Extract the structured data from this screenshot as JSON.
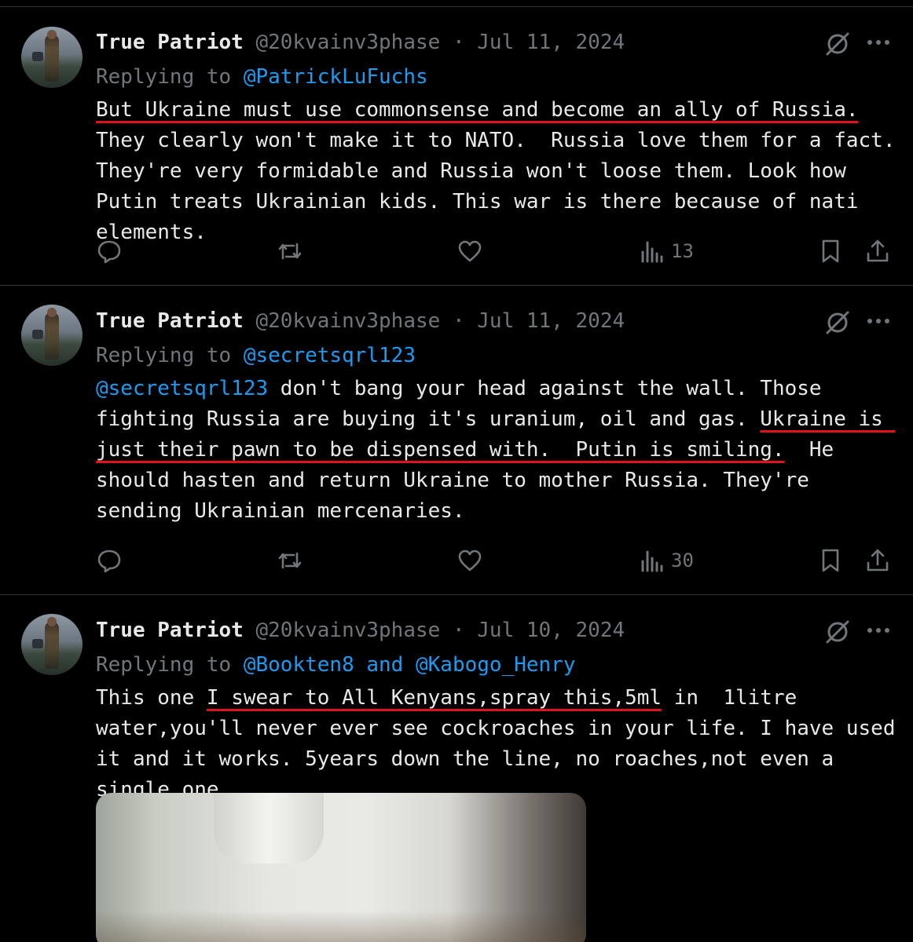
{
  "tweets": [
    {
      "author_name": "True Patriot",
      "handle": "@20kvainv3phase",
      "separator": "·",
      "date": "Jul 11, 2024",
      "replying_prefix": "Replying to ",
      "replying_to": "@PatrickLuFuchs",
      "text": {
        "underlined_1": "But Ukraine must use commonsense and become an ally of Russia.",
        "rest": "  They clearly won't make it to NATO.  Russia love them for a fact. They're very formidable and Russia won't loose them. Look how Putin treats Ukrainian kids. This war is there because of nati elements."
      },
      "views": "13"
    },
    {
      "author_name": "True Patriot",
      "handle": "@20kvainv3phase",
      "separator": "·",
      "date": "Jul 11, 2024",
      "replying_prefix": "Replying to ",
      "replying_to": "@secretsqrl123",
      "text": {
        "mention": "@secretsqrl123",
        "plain_1": " don't bang your head against the wall. Those fighting Russia are buying it's uranium, oil and gas. ",
        "underlined_1": "Ukraine is just their pawn to be dispensed with.  Putin is smiling.",
        "rest": "  He should hasten and return Ukraine to mother Russia. They're sending Ukrainian mercenaries."
      },
      "views": "30"
    },
    {
      "author_name": "True Patriot",
      "handle": "@20kvainv3phase",
      "separator": "·",
      "date": "Jul 10, 2024",
      "replying_prefix": "Replying to ",
      "replying_to": "@Bookten8 and @Kabogo_Henry",
      "text": {
        "plain_1": "This one ",
        "underlined_1": "I swear to All Kenyans,spray this,5ml",
        "rest": " in  1litre water,you'll never ever see cockroaches in your life. I have used it and it works. 5years down the line, no roaches,not even a single one."
      }
    }
  ],
  "colors": {
    "background": "#000000",
    "text": "#e7e9ea",
    "secondary": "#71767b",
    "link": "#1d9bf0",
    "annotation_red": "#e0121b",
    "divider": "#2f3336"
  },
  "icons": [
    "grok-icon",
    "more-icon",
    "reply-icon",
    "retweet-icon",
    "like-icon",
    "views-icon",
    "bookmark-icon",
    "share-icon"
  ]
}
